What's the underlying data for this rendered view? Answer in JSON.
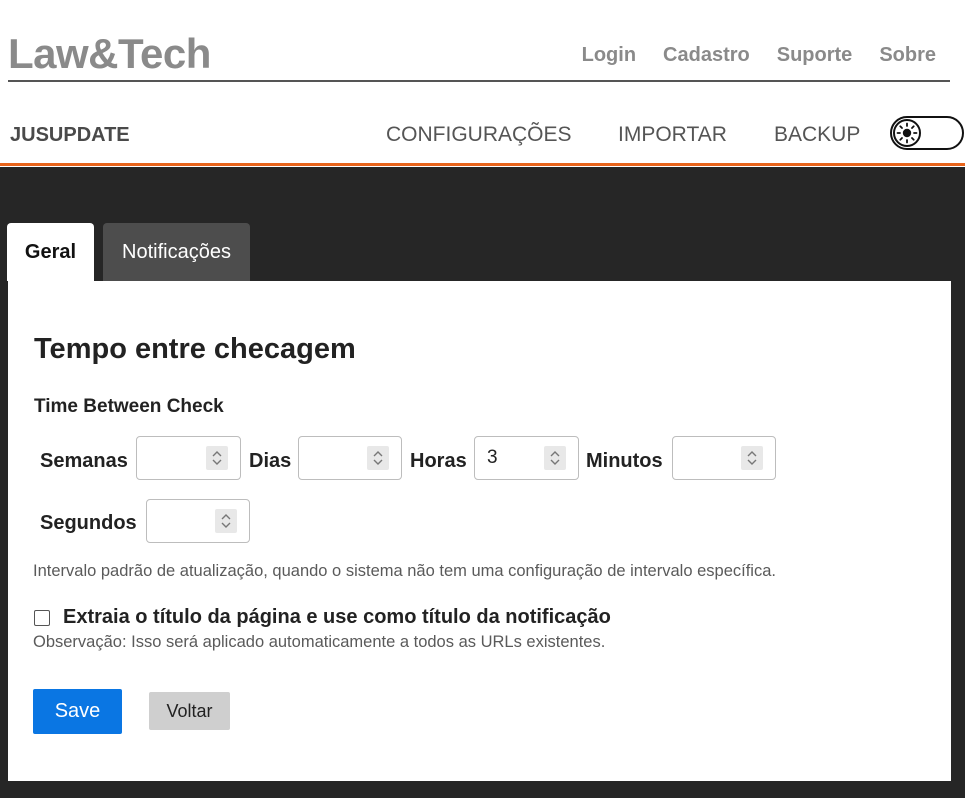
{
  "header": {
    "brand": "Law&Tech",
    "nav": [
      "Login",
      "Cadastro",
      "Suporte",
      "Sobre"
    ]
  },
  "subnav": {
    "app_name": "JUSUPDATE",
    "menu": [
      "CONFIGURAÇÕES",
      "IMPORTAR",
      "BACKUP"
    ],
    "theme_toggle_icon": "sun-icon"
  },
  "tabs": [
    {
      "label": "Geral",
      "active": true
    },
    {
      "label": "Notificações",
      "active": false
    }
  ],
  "section": {
    "title": "Tempo entre checagem",
    "subtitle": "Time Between Check"
  },
  "fields": {
    "semanas": {
      "label": "Semanas",
      "value": ""
    },
    "dias": {
      "label": "Dias",
      "value": ""
    },
    "horas": {
      "label": "Horas",
      "value": "3"
    },
    "minutos": {
      "label": "Minutos",
      "value": ""
    },
    "segundos": {
      "label": "Segundos",
      "value": ""
    }
  },
  "help_text": "Intervalo padrão de atualização, quando o sistema não tem uma configuração de intervalo específica.",
  "checkbox": {
    "label": "Extraia o título da página e use como título da notificação",
    "checked": false
  },
  "note": "Observação: Isso será aplicado automaticamente a todos as URLs existentes.",
  "buttons": {
    "save": "Save",
    "back": "Voltar"
  },
  "colors": {
    "accent_orange": "#e8641b",
    "primary_blue": "#0a76e3",
    "dark_bg": "#262626"
  }
}
